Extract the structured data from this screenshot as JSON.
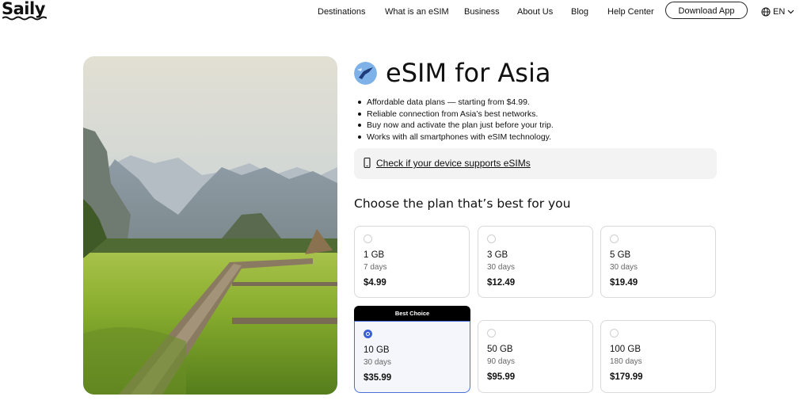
{
  "brand": {
    "name": "Saily"
  },
  "nav": {
    "items": [
      {
        "label": "Destinations"
      },
      {
        "label": "What is an eSIM"
      },
      {
        "label": "Business"
      },
      {
        "label": "About Us"
      },
      {
        "label": "Blog"
      },
      {
        "label": "Help Center"
      }
    ],
    "download_label": "Download App",
    "language": "EN",
    "icons": {
      "language": "globe-icon",
      "dropdown": "chevron-down-icon"
    }
  },
  "hero": {
    "image_description": "landscape-photo"
  },
  "product": {
    "title": "eSIM for Asia",
    "bullets": [
      "Affordable data plans — starting from $4.99.",
      "Reliable connection from Asia’s best networks.",
      "Buy now and activate the plan just before your trip.",
      "Works with all smartphones with eSIM technology."
    ],
    "check_device_label": "Check if your device supports eSIMs"
  },
  "plans": {
    "heading": "Choose the plan that’s best for you",
    "badge_label": "Best Choice",
    "items": [
      {
        "data": "1 GB",
        "duration": "7 days",
        "price": "$4.99",
        "selected": false
      },
      {
        "data": "3 GB",
        "duration": "30 days",
        "price": "$12.49",
        "selected": false
      },
      {
        "data": "5 GB",
        "duration": "30 days",
        "price": "$19.49",
        "selected": false
      },
      {
        "data": "10 GB",
        "duration": "30 days",
        "price": "$35.99",
        "selected": true
      },
      {
        "data": "50 GB",
        "duration": "90 days",
        "price": "$95.99",
        "selected": false
      },
      {
        "data": "100 GB",
        "duration": "180 days",
        "price": "$179.99",
        "selected": false
      }
    ]
  },
  "colors": {
    "accent": "#3a5fd9",
    "badge_bg": "#000000",
    "selected_bg": "#f4f6fb"
  }
}
